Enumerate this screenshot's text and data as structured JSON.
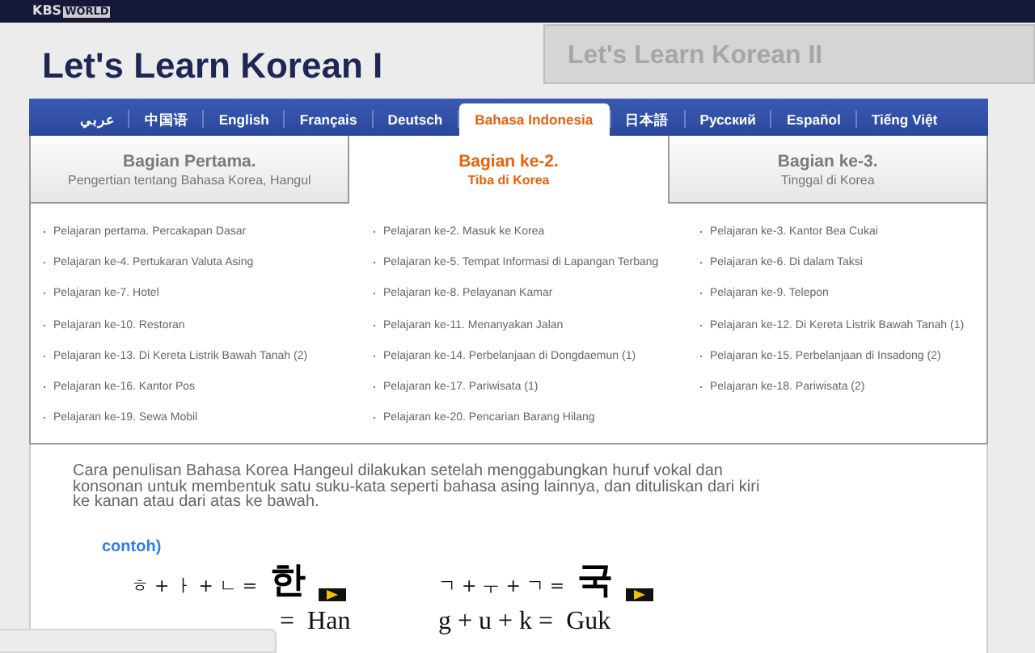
{
  "logo": {
    "brand": "KBS",
    "sub": "WORLD"
  },
  "courses": [
    {
      "title": "Let's Learn Korean I",
      "selected": true
    },
    {
      "title": "Let's Learn Korean II",
      "selected": false
    }
  ],
  "languages": [
    {
      "label": "عربي",
      "selected": false
    },
    {
      "label": "中国语",
      "selected": false
    },
    {
      "label": "English",
      "selected": false
    },
    {
      "label": "Français",
      "selected": false
    },
    {
      "label": "Deutsch",
      "selected": false
    },
    {
      "label": "Bahasa Indonesia",
      "selected": true
    },
    {
      "label": "日本語",
      "selected": false
    },
    {
      "label": "Русский",
      "selected": false
    },
    {
      "label": "Español",
      "selected": false
    },
    {
      "label": "Tiếng Việt",
      "selected": false
    }
  ],
  "parts": [
    {
      "title": "Bagian Pertama.",
      "subtitle": "Pengertian tentang Bahasa Korea, Hangul",
      "selected": false
    },
    {
      "title": "Bagian ke-2.",
      "subtitle": "Tiba di Korea",
      "selected": true
    },
    {
      "title": "Bagian ke-3.",
      "subtitle": "Tinggal di Korea",
      "selected": false
    }
  ],
  "lessons": [
    "Pelajaran pertama. Percakapan Dasar",
    "Pelajaran ke-2. Masuk ke Korea",
    "Pelajaran ke-3. Kantor Bea Cukai",
    "Pelajaran ke-4. Pertukaran Valuta Asing",
    "Pelajaran ke-5. Tempat Informasi di Lapangan Terbang",
    "Pelajaran ke-6. Di dalam Taksi",
    "Pelajaran ke-7. Hotel",
    "Pelajaran ke-8. Pelayanan Kamar",
    "Pelajaran ke-9. Telepon",
    "Pelajaran ke-10. Restoran",
    "Pelajaran ke-11. Menanyakan Jalan",
    "Pelajaran ke-12. Di Kereta Listrik Bawah Tanah (1)",
    "Pelajaran ke-13. Di Kereta Listrik Bawah Tanah (2)",
    "Pelajaran ke-14. Perbelanjaan di Dongdaemun (1)",
    "Pelajaran ke-15. Perbelanjaan di Insadong (2)",
    "Pelajaran ke-16. Kantor Pos",
    "Pelajaran ke-17. Pariwisata (1)",
    "Pelajaran ke-18. Pariwisata (2)",
    "Pelajaran ke-19. Sewa Mobil",
    "Pelajaran ke-20. Pencarian Barang Hilang"
  ],
  "intro": "Cara penulisan Bahasa Korea Hangeul dilakukan setelah menggabungkan huruf vokal dan konsonan untuk membentuk satu suku-kata seperti bahasa asing lainnya, dan dituliskan dari kiri ke kanan atau dari atas ke bawah.",
  "example_label": "contoh)",
  "examples": [
    {
      "jamo": "ㅎ + ㅏ + ㄴ =",
      "syllable": "한",
      "roman": "=",
      "roman_result": "Han"
    },
    {
      "jamo": "ㄱ + ㅜ + ㄱ =",
      "syllable": "국",
      "roman": "g + u + k =",
      "roman_result": "Guk"
    }
  ]
}
